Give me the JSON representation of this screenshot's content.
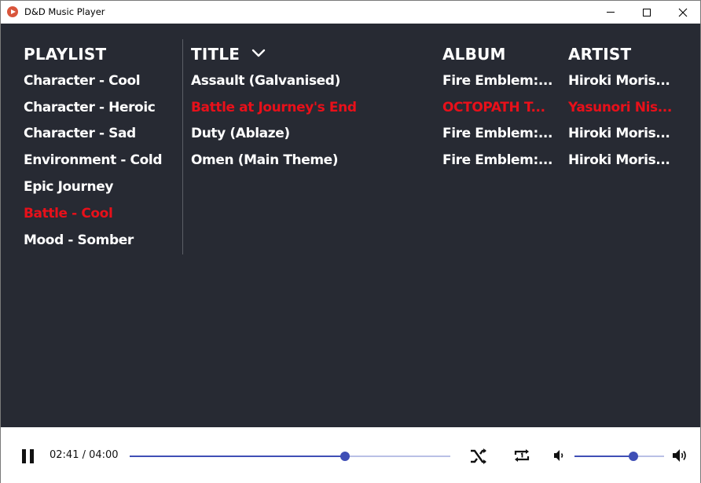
{
  "window": {
    "title": "D&D Music Player",
    "accent": "#d9553b"
  },
  "colors": {
    "background": "#272a33",
    "text": "#ffffff",
    "active": "#e8101a",
    "slider_accent": "#3f4fb6",
    "slider_track": "#b9c0e6"
  },
  "headers": {
    "playlist": "PLAYLIST",
    "title": "TITLE",
    "album": "ALBUM",
    "artist": "ARTIST",
    "sort_icon": "chevron-down-icon"
  },
  "playlists": [
    {
      "label": "Character - Cool",
      "active": false
    },
    {
      "label": "Character - Heroic",
      "active": false
    },
    {
      "label": "Character - Sad",
      "active": false
    },
    {
      "label": "Environment - Cold",
      "active": false
    },
    {
      "label": "Epic Journey",
      "active": false
    },
    {
      "label": "Battle - Cool",
      "active": true
    },
    {
      "label": "Mood - Somber",
      "active": false
    }
  ],
  "tracks": [
    {
      "title": "Assault (Galvanised)",
      "album": "Fire Emblem:...",
      "artist": "Hiroki Moris...",
      "active": false
    },
    {
      "title": "Battle at Journey's End",
      "album": "OCTOPATH T...",
      "artist": "Yasunori Nis...",
      "active": true
    },
    {
      "title": "Duty (Ablaze)",
      "album": "Fire Emblem:...",
      "artist": "Hiroki Moris...",
      "active": false
    },
    {
      "title": "Omen (Main Theme)",
      "album": "Fire Emblem:...",
      "artist": "Hiroki Moris...",
      "active": false
    }
  ],
  "player": {
    "time": "02:41 / 04:00",
    "progress_fraction": 0.671,
    "volume_fraction": 0.66,
    "icons": {
      "play_pause": "pause-icon",
      "shuffle": "shuffle-icon",
      "repeat": "repeat-one-icon",
      "volume_low": "volume-low-icon",
      "volume_high": "volume-high-icon"
    }
  }
}
